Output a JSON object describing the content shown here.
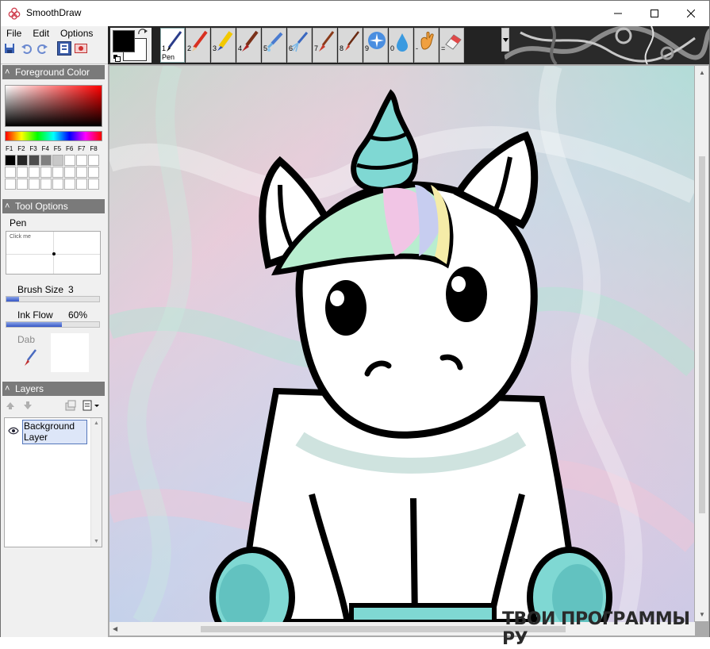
{
  "window": {
    "title": "SmoothDraw"
  },
  "menu": [
    "File",
    "Edit",
    "Options"
  ],
  "colors": {
    "foreground": "#000000",
    "background": "#ffffff",
    "panel_header": "#7a7a7a"
  },
  "brushes": [
    {
      "num": "1",
      "name": "Pen",
      "icon": "pen-icon",
      "active": true
    },
    {
      "num": "2",
      "name": "",
      "icon": "pencil-icon"
    },
    {
      "num": "3",
      "name": "",
      "icon": "marker-icon"
    },
    {
      "num": "4",
      "name": "",
      "icon": "brush-icon"
    },
    {
      "num": "5",
      "name": "",
      "icon": "airbrush-icon"
    },
    {
      "num": "6",
      "name": "",
      "icon": "spray-icon"
    },
    {
      "num": "7",
      "name": "",
      "icon": "oil-brush-icon"
    },
    {
      "num": "8",
      "name": "",
      "icon": "fine-brush-icon"
    },
    {
      "num": "9",
      "name": "",
      "icon": "sparkle-icon"
    },
    {
      "num": "0",
      "name": "",
      "icon": "water-drop-icon"
    },
    {
      "num": "-",
      "name": "",
      "icon": "smudge-hand-icon"
    },
    {
      "num": "=",
      "name": "",
      "icon": "eraser-icon"
    }
  ],
  "panels": {
    "foreground_color": {
      "title": "Foreground Color",
      "fkeys": [
        "F1",
        "F2",
        "F3",
        "F4",
        "F5",
        "F6",
        "F7",
        "F8"
      ],
      "swatches": [
        "#000000",
        "#262626",
        "#4d4d4d",
        "#808080",
        "#c8c8c8",
        "#ffffff",
        "#ffffff",
        "#ffffff",
        "#ffffff",
        "#ffffff",
        "#ffffff",
        "#ffffff",
        "#ffffff",
        "#ffffff",
        "#ffffff",
        "#ffffff",
        "#ffffff",
        "#ffffff",
        "#ffffff",
        "#ffffff",
        "#ffffff",
        "#ffffff",
        "#ffffff",
        "#ffffff"
      ]
    },
    "tool_options": {
      "title": "Tool Options",
      "tool_name": "Pen",
      "preview_hint": "Click me",
      "brush_size_label": "Brush Size",
      "brush_size_value": "3",
      "brush_size_fraction": 0.14,
      "ink_flow_label": "Ink Flow",
      "ink_flow_value": "60%",
      "ink_flow_fraction": 0.6,
      "dab_label": "Dab"
    },
    "layers": {
      "title": "Layers",
      "items": [
        {
          "name": "Background Layer",
          "visible": true
        }
      ]
    }
  },
  "watermark": "ТВОИ ПРОГРАММЫ РУ"
}
